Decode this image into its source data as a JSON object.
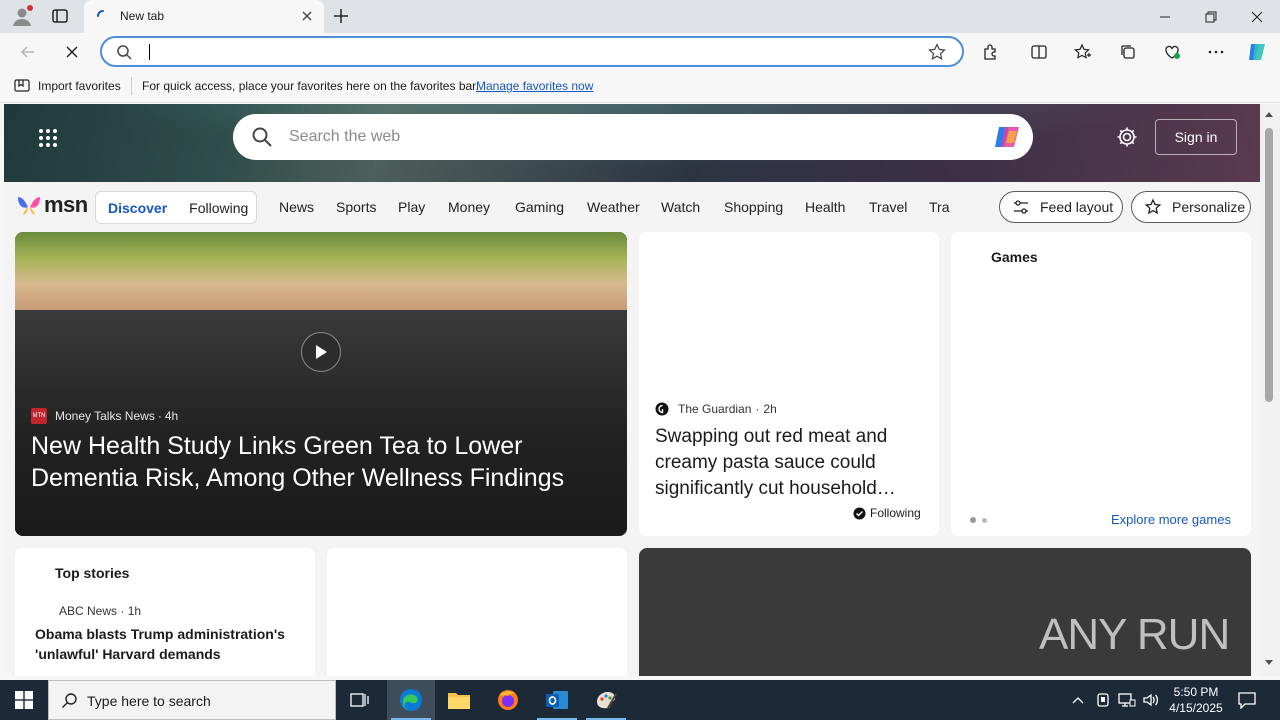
{
  "browser": {
    "tab_title": "New tab",
    "address_value": "",
    "favorites_bar": {
      "import_label": "Import favorites",
      "hint": "For quick access, place your favorites here on the favorites bar.",
      "manage_link": "Manage favorites now"
    }
  },
  "msn": {
    "search_placeholder": "Search the web",
    "sign_in": "Sign in",
    "logo_text": "msn",
    "segment": {
      "discover": "Discover",
      "following": "Following"
    },
    "nav": [
      "News",
      "Sports",
      "Play",
      "Money",
      "Gaming",
      "Weather",
      "Watch",
      "Shopping",
      "Health",
      "Travel",
      "Tra"
    ],
    "feed_layout": "Feed layout",
    "personalize": "Personalize",
    "hero": {
      "source": "Money Talks News",
      "source_badge": "MTN",
      "age": "4h",
      "title": "New Health Study Links Green Tea to Lower Dementia Risk, Among Other Wellness Findings"
    },
    "guardian": {
      "source": "The Guardian",
      "age": "2h",
      "title": "Swapping out red meat and creamy pasta sauce could significantly cut household…",
      "following": "Following"
    },
    "games": {
      "title": "Games",
      "explore": "Explore more games"
    },
    "top_stories": {
      "title": "Top stories",
      "source": "ABC News",
      "age": "1h",
      "headline": "Obama blasts Trump administration's 'unlawful' Harvard demands"
    },
    "watermark": "ANY RUN"
  },
  "taskbar": {
    "search_placeholder": "Type here to search",
    "time": "5:50 PM",
    "date": "4/15/2025"
  },
  "colors": {
    "accent": "#1558c0",
    "taskbar": "#1c2a38",
    "address_border": "#4f8fd9"
  }
}
